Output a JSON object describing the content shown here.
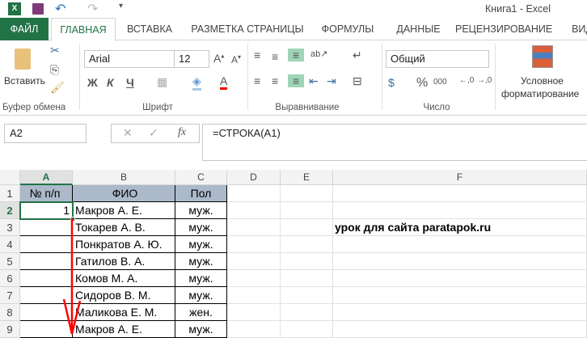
{
  "title": "Книга1 - Excel",
  "tabs": [
    "ФАЙЛ",
    "ГЛАВНАЯ",
    "ВСТАВКА",
    "РАЗМЕТКА СТРАНИЦЫ",
    "ФОРМУЛЫ",
    "ДАННЫЕ",
    "РЕЦЕНЗИРОВАНИЕ",
    "ВИД"
  ],
  "ribbon": {
    "paste": "Вставить",
    "clipboard": "Буфер обмена",
    "font_name": "Arial",
    "font_size": "12",
    "font_group": "Шрифт",
    "bold": "Ж",
    "italic": "К",
    "underline": "Ч",
    "align_group": "Выравнивание",
    "number_format": "Общий",
    "number_group": "Число",
    "percent": "%",
    "thousands": "000",
    "cond1": "Условное",
    "cond2": "форматирование"
  },
  "formula_bar": {
    "name_box": "A2",
    "fx": "fx",
    "formula": "=СТРОКА(A1)"
  },
  "columns": [
    "A",
    "B",
    "C",
    "D",
    "E",
    "F"
  ],
  "rows": [
    {
      "n": "1",
      "a": "№ п/п",
      "b": "ФИО",
      "c": "Пол"
    },
    {
      "n": "2",
      "a": "1",
      "b": "Макров А. Е.",
      "c": "муж."
    },
    {
      "n": "3",
      "a": "",
      "b": "Токарев А. В.",
      "c": "муж."
    },
    {
      "n": "4",
      "a": "",
      "b": "Понкратов А. Ю.",
      "c": "муж."
    },
    {
      "n": "5",
      "a": "",
      "b": "Гатилов В. А.",
      "c": "муж."
    },
    {
      "n": "6",
      "a": "",
      "b": "Комов М. А.",
      "c": "муж."
    },
    {
      "n": "7",
      "a": "",
      "b": "Сидоров В. М.",
      "c": "муж."
    },
    {
      "n": "8",
      "a": "",
      "b": "Маликова Е. М.",
      "c": "жен."
    },
    {
      "n": "9",
      "a": "",
      "b": "Макров А. Е.",
      "c": "муж."
    }
  ],
  "note": "урок для сайта paratapok.ru",
  "colors": {
    "accent": "#217346",
    "header_fill": "#acb9ca",
    "arrow": "#ff0000"
  }
}
